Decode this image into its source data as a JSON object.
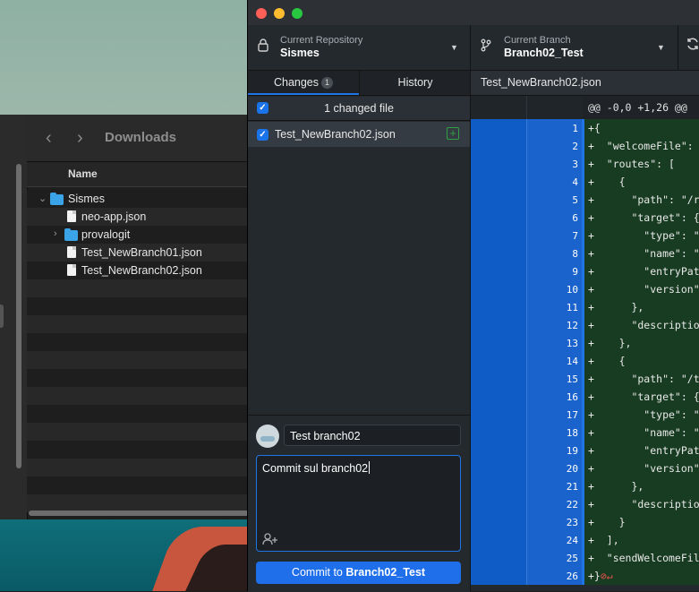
{
  "finder": {
    "title": "Downloads",
    "back_icon": "chevron-left-icon",
    "forward_icon": "chevron-right-icon",
    "column_header": "Name",
    "items": [
      {
        "label": "Sismes",
        "type": "folder",
        "expanded": true,
        "depth": 0
      },
      {
        "label": "neo-app.json",
        "type": "file",
        "depth": 1
      },
      {
        "label": "provalogit",
        "type": "folder",
        "expanded": false,
        "depth": 1
      },
      {
        "label": "Test_NewBranch01.json",
        "type": "file",
        "depth": 1
      },
      {
        "label": "Test_NewBranch02.json",
        "type": "file",
        "depth": 1
      }
    ]
  },
  "toolbar": {
    "repo_label": "Current Repository",
    "repo_value": "Sismes",
    "branch_label": "Current Branch",
    "branch_value": "Branch02_Test"
  },
  "sidebar": {
    "tabs": [
      {
        "label": "Changes",
        "badge": "1",
        "active": true
      },
      {
        "label": "History",
        "active": false
      }
    ],
    "changed_files_summary": "1 changed file",
    "files": [
      {
        "name": "Test_NewBranch02.json",
        "checked": true,
        "status": "added"
      }
    ]
  },
  "commit": {
    "summary": "Test branch02",
    "description": "Commit sul branch02",
    "button_prefix": "Commit to ",
    "button_branch": "Branch02_Test"
  },
  "diff": {
    "file_name": "Test_NewBranch02.json",
    "hunk_header": "@@ -0,0 +1,26 @@",
    "lines": [
      {
        "num": "1",
        "text": "+{"
      },
      {
        "num": "2",
        "text": "+  \"welcomeFile\": \""
      },
      {
        "num": "3",
        "text": "+  \"routes\": ["
      },
      {
        "num": "4",
        "text": "+    {"
      },
      {
        "num": "5",
        "text": "+      \"path\": \"/re"
      },
      {
        "num": "6",
        "text": "+      \"target\": {"
      },
      {
        "num": "7",
        "text": "+        \"type\": \"s"
      },
      {
        "num": "8",
        "text": "+        \"name\": \"s"
      },
      {
        "num": "9",
        "text": "+        \"entryPath"
      },
      {
        "num": "10",
        "text": "+        \"version\":"
      },
      {
        "num": "11",
        "text": "+      },"
      },
      {
        "num": "12",
        "text": "+      \"description"
      },
      {
        "num": "13",
        "text": "+    },"
      },
      {
        "num": "14",
        "text": "+    {"
      },
      {
        "num": "15",
        "text": "+      \"path\": \"/te"
      },
      {
        "num": "16",
        "text": "+      \"target\": {"
      },
      {
        "num": "17",
        "text": "+        \"type\": \"s"
      },
      {
        "num": "18",
        "text": "+        \"name\": \"s"
      },
      {
        "num": "19",
        "text": "+        \"entryPath"
      },
      {
        "num": "20",
        "text": "+        \"version\":"
      },
      {
        "num": "21",
        "text": "+      },"
      },
      {
        "num": "22",
        "text": "+      \"description"
      },
      {
        "num": "23",
        "text": "+    }"
      },
      {
        "num": "24",
        "text": "+  ],"
      },
      {
        "num": "25",
        "text": "+  \"sendWelcomeFile"
      },
      {
        "num": "26",
        "text": "+}"
      }
    ]
  },
  "colors": {
    "accent": "#1f6fea",
    "added_bg": "#183c22",
    "added_icon": "#2ea043",
    "no_newline": "#e5534b"
  }
}
